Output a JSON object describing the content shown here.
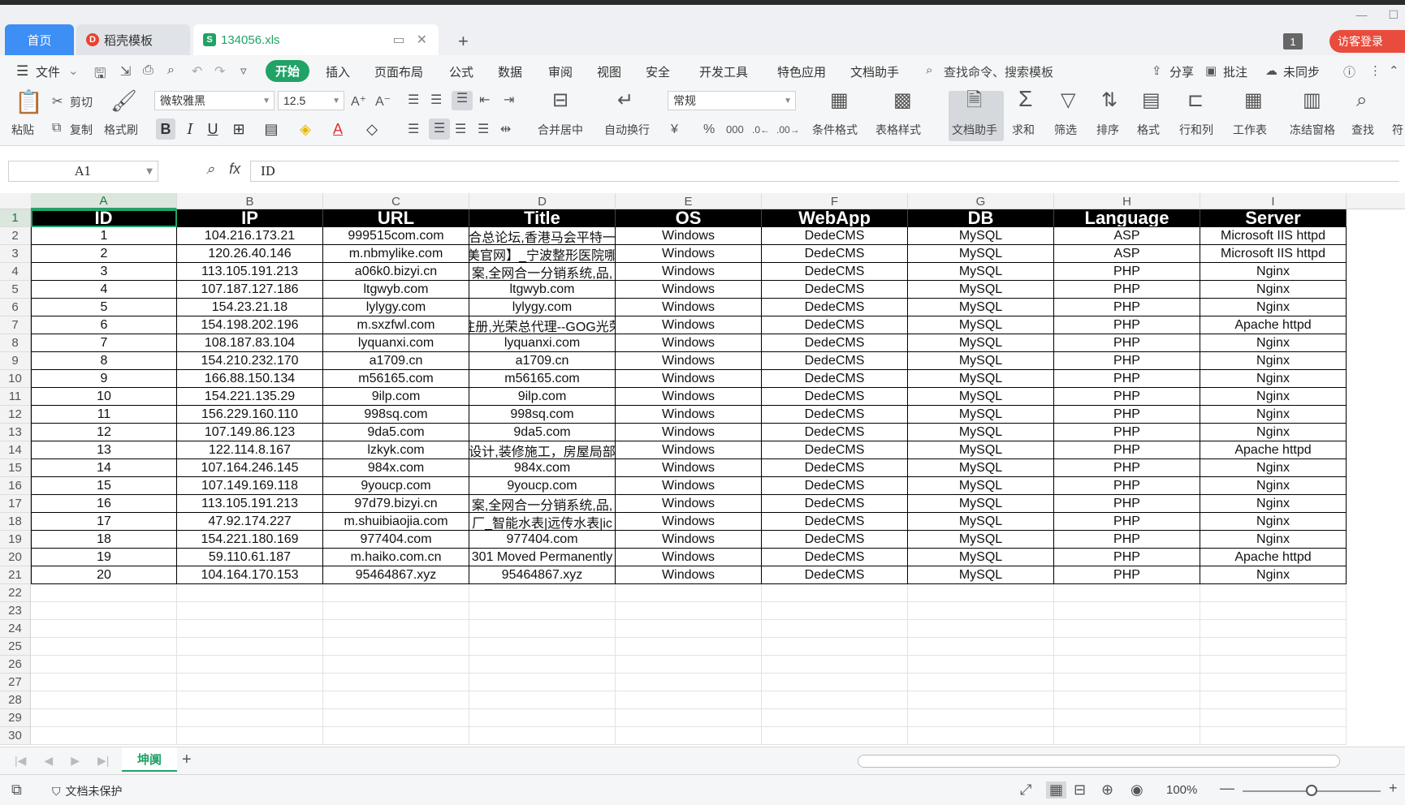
{
  "tabs": {
    "home": "首页",
    "template": "稻壳模板",
    "file": "134056.xls",
    "add": "+",
    "page_counter": "1",
    "guest_login": "访客登录"
  },
  "menu": {
    "file": "文件",
    "items": [
      "开始",
      "插入",
      "页面布局",
      "公式",
      "数据",
      "审阅",
      "视图",
      "安全",
      "开发工具",
      "特色应用",
      "文档助手"
    ],
    "search": "查找命令、搜索模板",
    "share": "分享",
    "comment": "批注",
    "sync": "未同步"
  },
  "ribbon": {
    "paste": "粘贴",
    "cut": "剪切",
    "copy": "复制",
    "format_painter": "格式刷",
    "font_name": "微软雅黑",
    "font_size": "12.5",
    "merge_center": "合并居中",
    "auto_wrap": "自动换行",
    "number_format": "常规",
    "conditional_format": "条件格式",
    "table_style": "表格样式",
    "doc_assistant": "文档助手",
    "sum": "求和",
    "filter": "筛选",
    "sort": "排序",
    "format": "格式",
    "row_col": "行和列",
    "worksheet": "工作表",
    "freeze": "冻结窗格",
    "find": "查找",
    "symbol": "符"
  },
  "formula_bar": {
    "cell_ref": "A1",
    "fx": "fx",
    "content": "ID"
  },
  "columns": [
    "A",
    "B",
    "C",
    "D",
    "E",
    "F",
    "G",
    "H",
    "I"
  ],
  "row_numbers": [
    "1",
    "2",
    "3",
    "4",
    "5",
    "6",
    "7",
    "8",
    "9",
    "10",
    "11",
    "12",
    "13",
    "14",
    "15",
    "16",
    "17",
    "18",
    "19",
    "20",
    "21",
    "22",
    "23",
    "24",
    "25",
    "26",
    "27",
    "28",
    "29",
    "30"
  ],
  "table": {
    "headers": [
      "ID",
      "IP",
      "URL",
      "Title",
      "OS",
      "WebApp",
      "DB",
      "Language",
      "Server"
    ],
    "rows": [
      [
        "1",
        "104.216.173.21",
        "999515com.com",
        "合总论坛,香港马会平特一",
        "Windows",
        "DedeCMS",
        "MySQL",
        "ASP",
        "Microsoft IIS httpd"
      ],
      [
        "2",
        "120.26.40.146",
        "m.nbmylike.com",
        "美官网】_宁波整形医院哪",
        "Windows",
        "DedeCMS",
        "MySQL",
        "ASP",
        "Microsoft IIS httpd"
      ],
      [
        "3",
        "113.105.191.213",
        "a06k0.bizyi.cn",
        "案,全网合一分销系统,品,",
        "Windows",
        "DedeCMS",
        "MySQL",
        "PHP",
        "Nginx"
      ],
      [
        "4",
        "107.187.127.186",
        "ltgwyb.com",
        "ltgwyb.com",
        "Windows",
        "DedeCMS",
        "MySQL",
        "PHP",
        "Nginx"
      ],
      [
        "5",
        "154.23.21.18",
        "lylygy.com",
        "lylygy.com",
        "Windows",
        "DedeCMS",
        "MySQL",
        "PHP",
        "Nginx"
      ],
      [
        "6",
        "154.198.202.196",
        "m.sxzfwl.com",
        "注册,光荣总代理--GOG光荣",
        "Windows",
        "DedeCMS",
        "MySQL",
        "PHP",
        "Apache httpd"
      ],
      [
        "7",
        "108.187.83.104",
        "lyquanxi.com",
        "lyquanxi.com",
        "Windows",
        "DedeCMS",
        "MySQL",
        "PHP",
        "Nginx"
      ],
      [
        "8",
        "154.210.232.170",
        "a1709.cn",
        "a1709.cn",
        "Windows",
        "DedeCMS",
        "MySQL",
        "PHP",
        "Nginx"
      ],
      [
        "9",
        "166.88.150.134",
        "m56165.com",
        "m56165.com",
        "Windows",
        "DedeCMS",
        "MySQL",
        "PHP",
        "Nginx"
      ],
      [
        "10",
        "154.221.135.29",
        "9ilp.com",
        "9ilp.com",
        "Windows",
        "DedeCMS",
        "MySQL",
        "PHP",
        "Nginx"
      ],
      [
        "11",
        "156.229.160.110",
        "998sq.com",
        "998sq.com",
        "Windows",
        "DedeCMS",
        "MySQL",
        "PHP",
        "Nginx"
      ],
      [
        "12",
        "107.149.86.123",
        "9da5.com",
        "9da5.com",
        "Windows",
        "DedeCMS",
        "MySQL",
        "PHP",
        "Nginx"
      ],
      [
        "13",
        "122.114.8.167",
        "lzkyk.com",
        "设计,装修施工，房屋局部",
        "Windows",
        "DedeCMS",
        "MySQL",
        "PHP",
        "Apache httpd"
      ],
      [
        "14",
        "107.164.246.145",
        "984x.com",
        "984x.com",
        "Windows",
        "DedeCMS",
        "MySQL",
        "PHP",
        "Nginx"
      ],
      [
        "15",
        "107.149.169.118",
        "9youcp.com",
        "9youcp.com",
        "Windows",
        "DedeCMS",
        "MySQL",
        "PHP",
        "Nginx"
      ],
      [
        "16",
        "113.105.191.213",
        "97d79.bizyi.cn",
        "案,全网合一分销系统,品,",
        "Windows",
        "DedeCMS",
        "MySQL",
        "PHP",
        "Nginx"
      ],
      [
        "17",
        "47.92.174.227",
        "m.shuibiaojia.com",
        "厂_智能水表|远传水表|ic",
        "Windows",
        "DedeCMS",
        "MySQL",
        "PHP",
        "Nginx"
      ],
      [
        "18",
        "154.221.180.169",
        "977404.com",
        "977404.com",
        "Windows",
        "DedeCMS",
        "MySQL",
        "PHP",
        "Nginx"
      ],
      [
        "19",
        "59.110.61.187",
        "m.haiko.com.cn",
        "301 Moved Permanently",
        "Windows",
        "DedeCMS",
        "MySQL",
        "PHP",
        "Apache httpd"
      ],
      [
        "20",
        "104.164.170.153",
        "95464867.xyz",
        "95464867.xyz",
        "Windows",
        "DedeCMS",
        "MySQL",
        "PHP",
        "Nginx"
      ]
    ]
  },
  "sheet": {
    "tab_name": "坤阒",
    "add": "+"
  },
  "status": {
    "doc_protect": "文档未保护",
    "zoom": "100%",
    "zoom_level": 1.0
  }
}
